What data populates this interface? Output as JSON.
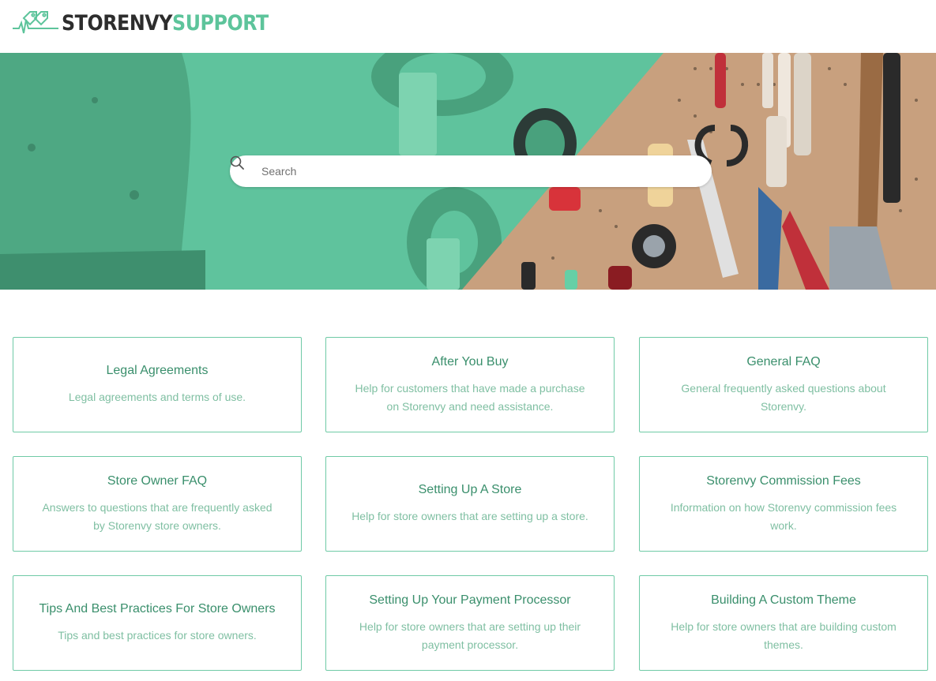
{
  "brand": {
    "name_part1": "STORENVY",
    "name_part2": "SUPPORT",
    "primary_color": "#5dc49b",
    "dark_color": "#2d2d2d"
  },
  "search": {
    "placeholder": "Search",
    "icon": "search-icon"
  },
  "categories": [
    {
      "title": "Legal Agreements",
      "description": "Legal agreements and terms of use."
    },
    {
      "title": "After You Buy",
      "description": "Help for customers that have made a purchase on Storenvy and need assistance."
    },
    {
      "title": "General FAQ",
      "description": "General frequently asked questions about Storenvy."
    },
    {
      "title": "Store Owner FAQ",
      "description": "Answers to questions that are frequently asked by Storenvy store owners."
    },
    {
      "title": "Setting Up A Store",
      "description": "Help for store owners that are setting up a store."
    },
    {
      "title": "Storenvy Commission Fees",
      "description": "Information on how Storenvy commission fees work."
    },
    {
      "title": "Tips And Best Practices For Store Owners",
      "description": "Tips and best practices for store owners."
    },
    {
      "title": "Setting Up Your Payment Processor",
      "description": "Help for store owners that are setting up their payment processor."
    },
    {
      "title": "Building A Custom Theme",
      "description": "Help for store owners that are building custom themes."
    }
  ]
}
